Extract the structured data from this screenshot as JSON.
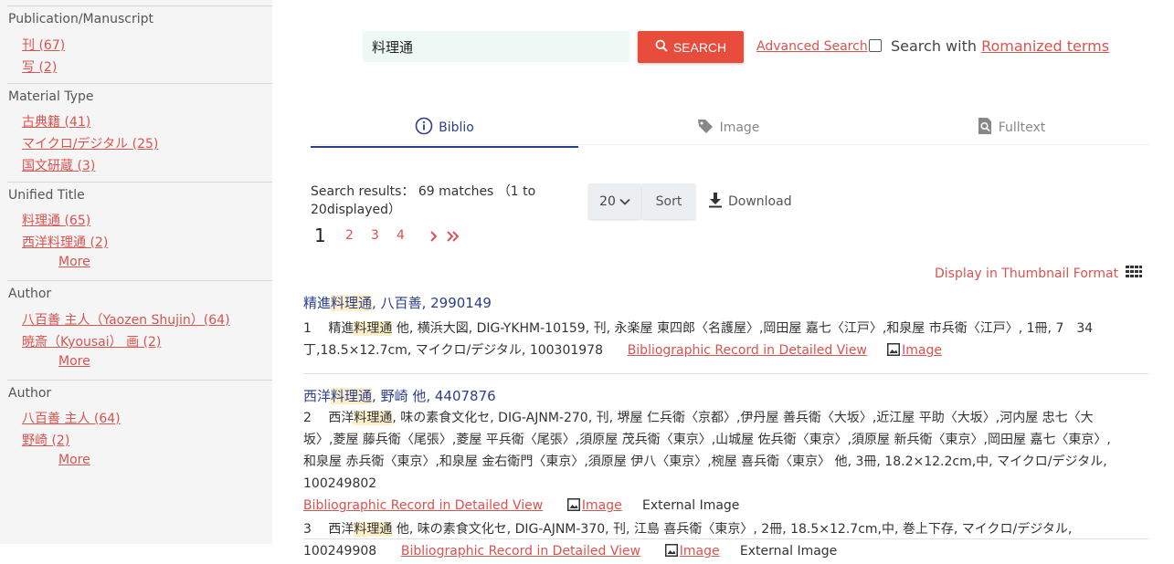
{
  "sidebar": {
    "facets": [
      {
        "title": "Publication/Manuscript",
        "items": [
          "刊 (67)",
          "写 (2)"
        ]
      },
      {
        "title": "Material Type",
        "items": [
          "古典籍 (41)",
          "マイクロ/デジタル (25)",
          "国文研蔵 (3)"
        ]
      },
      {
        "title": "Unified Title",
        "items": [
          "料理通 (65)",
          "西洋料理通 (2)"
        ],
        "more": "More"
      },
      {
        "title": "Author",
        "items": [
          "八百善 主人（Yaozen Shujin）(64)",
          "暁斎（Kyousai） 画 (2)"
        ],
        "more": "More"
      },
      {
        "title": "Author",
        "items": [
          "八百善 主人 (64)",
          "野崎 (2)"
        ],
        "more": "More"
      }
    ]
  },
  "search": {
    "value": "料理通",
    "button_label": "SEARCH",
    "advanced_label": "Advanced Search",
    "romanized_prefix": "Search with ",
    "romanized_link": "Romanized terms"
  },
  "tabs": [
    {
      "label": "Biblio",
      "icon": "info-icon",
      "active": true
    },
    {
      "label": "Image",
      "icon": "tag-icon",
      "active": false
    },
    {
      "label": "Fulltext",
      "icon": "fulltext-search-icon",
      "active": false
    }
  ],
  "results": {
    "summary_line1": "Search results： 69 matches （1 to",
    "summary_line2": "20displayed）",
    "per_page": "20",
    "sort_label": "Sort",
    "download_label": "Download",
    "pages": [
      "1",
      "2",
      "3",
      "4"
    ],
    "current_page": "1",
    "thumbnail_label": "Display in Thumbnail Format"
  },
  "records": [
    {
      "title_pre": "精進",
      "title_hl": "料理通",
      "title_post": ", 八百善, 2990149",
      "entries": [
        {
          "no": "1",
          "pre": "精進",
          "hl": "料理通",
          "text": " 他, 横浜大図, DIG-YKHM-10159, 刊, 永楽屋 東四郎〈名護屋〉,岡田屋 嘉七〈江戸〉,和泉屋 市兵衛〈江戸〉, 1冊, 7　34丁,18.5×12.7cm, マイクロ/デジタル, 100301978",
          "detail_link": "Bibliographic Record in Detailed View",
          "image_link": "Image",
          "external": ""
        }
      ]
    },
    {
      "title_pre": "西洋",
      "title_hl": "料理通",
      "title_post": ", 野崎 他, 4407876",
      "entries": [
        {
          "no": "2",
          "pre": "西洋",
          "hl": "料理通",
          "text": ", 味の素食文化セ, DIG-AJNM-270, 刊, 堺屋 仁兵衛〈京都〉,伊丹屋 善兵衛〈大坂〉,近江屋 平助〈大坂〉,河内屋 忠七〈大坂〉,菱屋 藤兵衛〈尾張〉,菱屋 平兵衛〈尾張〉,須原屋 茂兵衛〈東京〉,山城屋 佐兵衛〈東京〉,須原屋 新兵衛〈東京〉,岡田屋 嘉七〈東京〉,和泉屋 赤兵衛〈東京〉,和泉屋 金右衛門〈東京〉,須原屋 伊八〈東京〉,椀屋 喜兵衛〈東京〉 他, 3冊, 18.2×12.2cm,中, マイクロ/デジタル, 100249802",
          "detail_link": "Bibliographic Record in Detailed View",
          "image_link": "Image",
          "external": "External Image"
        },
        {
          "no": "3",
          "pre": "西洋",
          "hl": "料理通",
          "text": " 他, 味の素食文化セ, DIG-AJNM-370, 刊, 江島 喜兵衛〈東京〉, 2冊, 18.5×12.7cm,中, 巻上下存, マイクロ/デジタル, 100249908",
          "detail_link": "Bibliographic Record in Detailed View",
          "image_link": "Image",
          "external": "External Image"
        }
      ]
    }
  ],
  "colors": {
    "accent": "#e74c3c",
    "link": "#d9534f",
    "tab_active": "#2c3e8c",
    "highlight": "#fdf0c9"
  }
}
